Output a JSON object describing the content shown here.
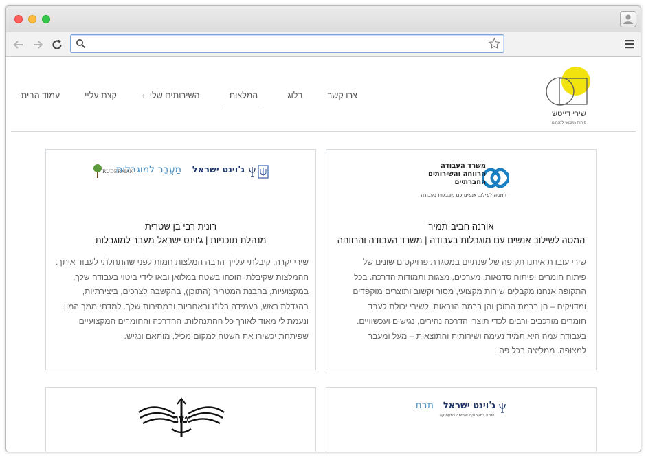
{
  "browser": {
    "url": "",
    "icons": {
      "back": "arrow-left-icon",
      "forward": "arrow-right-icon",
      "reload": "reload-icon",
      "search": "search-icon",
      "bookmark": "star-icon",
      "menu": "hamburger-menu-icon",
      "profile": "profile-icon"
    }
  },
  "site": {
    "logo_name": "שירי דייטש",
    "logo_tagline": "פיתוח מקצועי למנחים",
    "colors": {
      "accent": "#f2e30f",
      "text": "#555555",
      "border": "#d6dbe0"
    },
    "nav": [
      {
        "label": "עמוד הבית"
      },
      {
        "label": "קצת עליי"
      },
      {
        "label": "השירותים שלי",
        "plus": "+"
      },
      {
        "label": "המלצות",
        "active": true
      },
      {
        "label": "בלוג"
      },
      {
        "label": "צרו קשר"
      }
    ]
  },
  "testimonials": [
    {
      "logo_text_line1": "משרד העבודה",
      "logo_text_line2": "הרווחה והשירותים",
      "logo_text_line3": "החברתיים",
      "logo_text_sub": "המטה לשילוב אנשים עם מוגבלות בעבודה",
      "name": "אורנה חביב-תמיר",
      "role": "המטה לשילוב אנשים עם מוגבלות בעבודה | משרד העבודה והרווחה",
      "lines": [
        "שירי עובדת איתנו תקופה של שנתיים במסגרת פרויקטים שונים של",
        "פיתוח חומרים ופיתוח סדנאות, מערכים, מצגות ותמודות הדרכה. בכל",
        "התקופה אנחנו מקבלים שירות מקצועי, מסור וקשוב ותוצרים מוקפדים",
        "ומדויקים – הן ברמת התוכן והן ברמת הנראות. לשירי יכולת לעבד",
        "חומרים מורכבים ורבים לכדי תוצרי הדרכה נהירים, נגישים ועכשוויים.",
        "בעבודה עמה היא תמיד נעימה ושירותית והתוצאות – מעל ומעבר",
        "למצופה. ממליצה בכל פה!"
      ]
    },
    {
      "logo_text_main": "ג'וינט ישראל",
      "logo_text_sub": "מַעֲבָר למוגבלות",
      "logo_partner": "RUDERMAN",
      "name": "רונית רבי בן שטרית",
      "role": "מנהלת תוכניות | ג'וינט ישראל-מעבר למוגבלות",
      "lines": [
        "שירי יקרה, קיבלתי עלייך הרבה המלצות חמות לפני שהתחלתי לעבוד איתך.",
        "ההמלצות שקיבלתי הוכחו בשטח במלואן ובאו לידי ביטוי בעבודה שלך,",
        "במקצועיות, בהבנת המטריה (התוכן), בהקשבה לצרכים, ביצירתיות,",
        "בהגדלת ראש, בעמידה בלו\"ז ובאחריות ובמסירות שלך. למדתי ממך המון",
        "ונעמת לי מאוד לאורך כל ההתנהלות. ההדרכה והחומרים המקצועיים",
        "שפיתחת יכשירו את השטח למקום מכיל, מותאם ונגיש."
      ]
    },
    {
      "logo_text_main": "ג'וינט ישראל",
      "logo_text_sub": "תבת",
      "logo_text_small": "יוזמה לתעסוקה וצמיחה בתעסוקה"
    },
    {
      "logo_text": "טוב"
    }
  ]
}
